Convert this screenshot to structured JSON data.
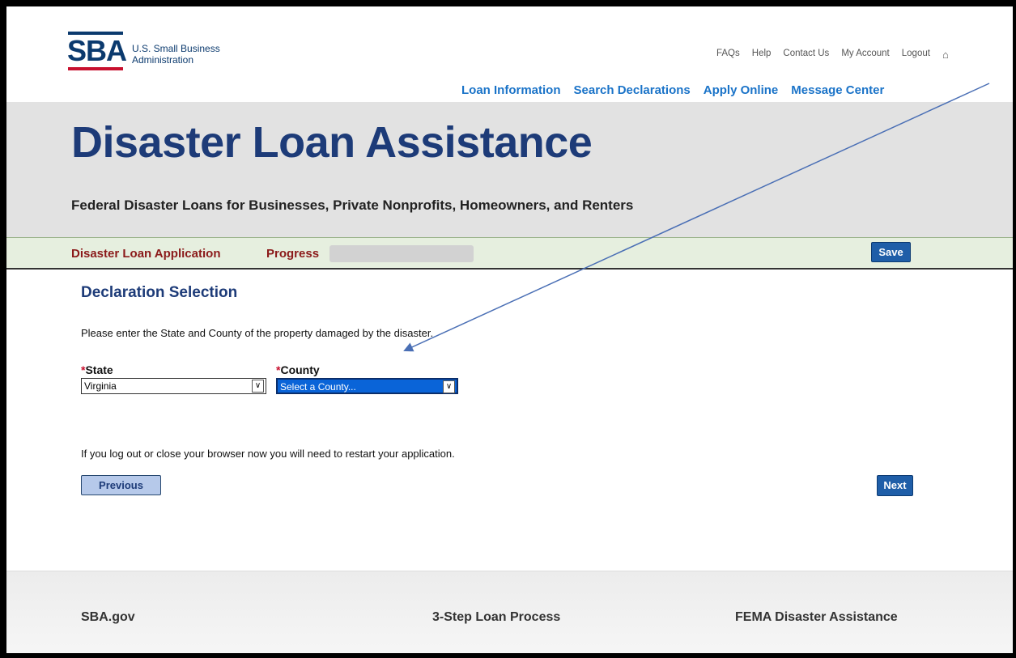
{
  "logo": {
    "letters": "SBA",
    "line1": "U.S. Small Business",
    "line2": "Administration"
  },
  "utility_links": [
    "FAQs",
    "Help",
    "Contact Us",
    "My Account",
    "Logout"
  ],
  "main_nav": [
    "Loan Information",
    "Search Declarations",
    "Apply Online",
    "Message Center"
  ],
  "banner": {
    "title": "Disaster Loan Assistance",
    "subtitle": "Federal Disaster Loans for Businesses, Private Nonprofits, Homeowners, and Renters"
  },
  "appbar": {
    "title": "Disaster Loan Application",
    "progress_label": "Progress",
    "progress_fraction": 0.0,
    "save_label": "Save"
  },
  "content": {
    "section_title": "Declaration Selection",
    "instructions": "Please enter the State and County of the property damaged by the disaster.",
    "required_marker": "*",
    "state_label": "State",
    "state_value": "Virginia",
    "county_label": "County",
    "county_value": "Select a County...",
    "notice": "If you log out or close your browser now you will need to restart your application.",
    "previous_label": "Previous",
    "next_label": "Next"
  },
  "footer": {
    "link1": "SBA.gov",
    "link2": "3-Step Loan Process",
    "link3": "FEMA Disaster Assistance"
  },
  "colors": {
    "brand_navy": "#1d3b78",
    "link_blue": "#1a73c8",
    "appbar_red": "#8b1a1a",
    "button_blue": "#1f5ea8",
    "annotation_arrow": "#4a6fb5"
  },
  "icons": [
    "home-icon",
    "dropdown-arrow-icon",
    "annotation-arrow"
  ]
}
